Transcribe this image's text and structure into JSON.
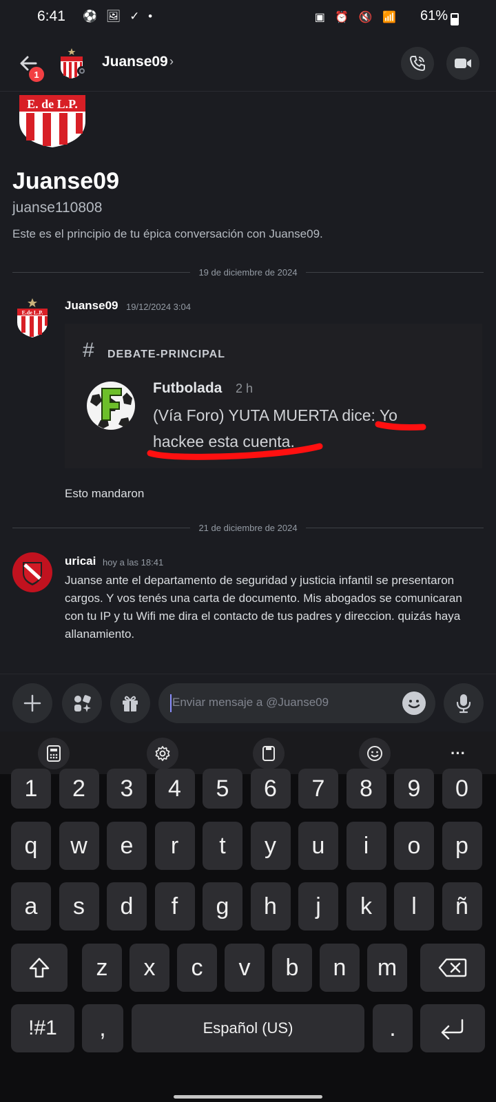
{
  "status_bar": {
    "time": "6:41",
    "left_icons": "⚽ 🖼 ✓ •",
    "right_icons": "▣ ⏰ 🔇 📶",
    "battery": "61%",
    "battery_level": 0.61
  },
  "header": {
    "unread_badge": "1",
    "title": "Juanse09",
    "chevron": "›"
  },
  "intro": {
    "display_name": "Juanse09",
    "username": "juanse110808",
    "text": "Este es el principio de tu épica conversación con Juanse09."
  },
  "dividers": [
    "19 de diciembre de 2024",
    "21 de diciembre de 2024"
  ],
  "messages": [
    {
      "author": "Juanse09",
      "timestamp": "19/12/2024 3:04",
      "embed": {
        "channel": "DEBATE-PRINCIPAL",
        "author": "Futbolada",
        "ago": "2 h",
        "line1": "(Vía Foro) YUTA MUERTA dice: Yo",
        "line2": "hackee esta cuenta."
      },
      "text": "Esto mandaron"
    },
    {
      "author": "uricai",
      "timestamp": "hoy a las 18:41",
      "text": "Juanse ante el departamento de seguridad y justicia infantil se presentaron cargos. Y vos tenés una carta de documento. Mis abogados se comunicaran con tu IP y tu Wifi me dira el contacto de tus padres y direccion. quizás haya allanamiento."
    }
  ],
  "composer": {
    "placeholder": "Enviar mensaje a @Juanse09"
  },
  "keyboard": {
    "row_numbers": [
      "1",
      "2",
      "3",
      "4",
      "5",
      "6",
      "7",
      "8",
      "9",
      "0"
    ],
    "row1": [
      "q",
      "w",
      "e",
      "r",
      "t",
      "y",
      "u",
      "i",
      "o",
      "p"
    ],
    "row2": [
      "a",
      "s",
      "d",
      "f",
      "g",
      "h",
      "j",
      "k",
      "l",
      "ñ"
    ],
    "row3": [
      "z",
      "x",
      "c",
      "v",
      "b",
      "n",
      "m"
    ],
    "symbols_key": "!#1",
    "comma_key": ",",
    "space_label": "Español (US)",
    "period_key": ".",
    "toolbar_more": "···"
  },
  "colors": {
    "background": "#1b1c21",
    "accent_red": "#f23f43",
    "annotation_red": "#ff0000"
  }
}
